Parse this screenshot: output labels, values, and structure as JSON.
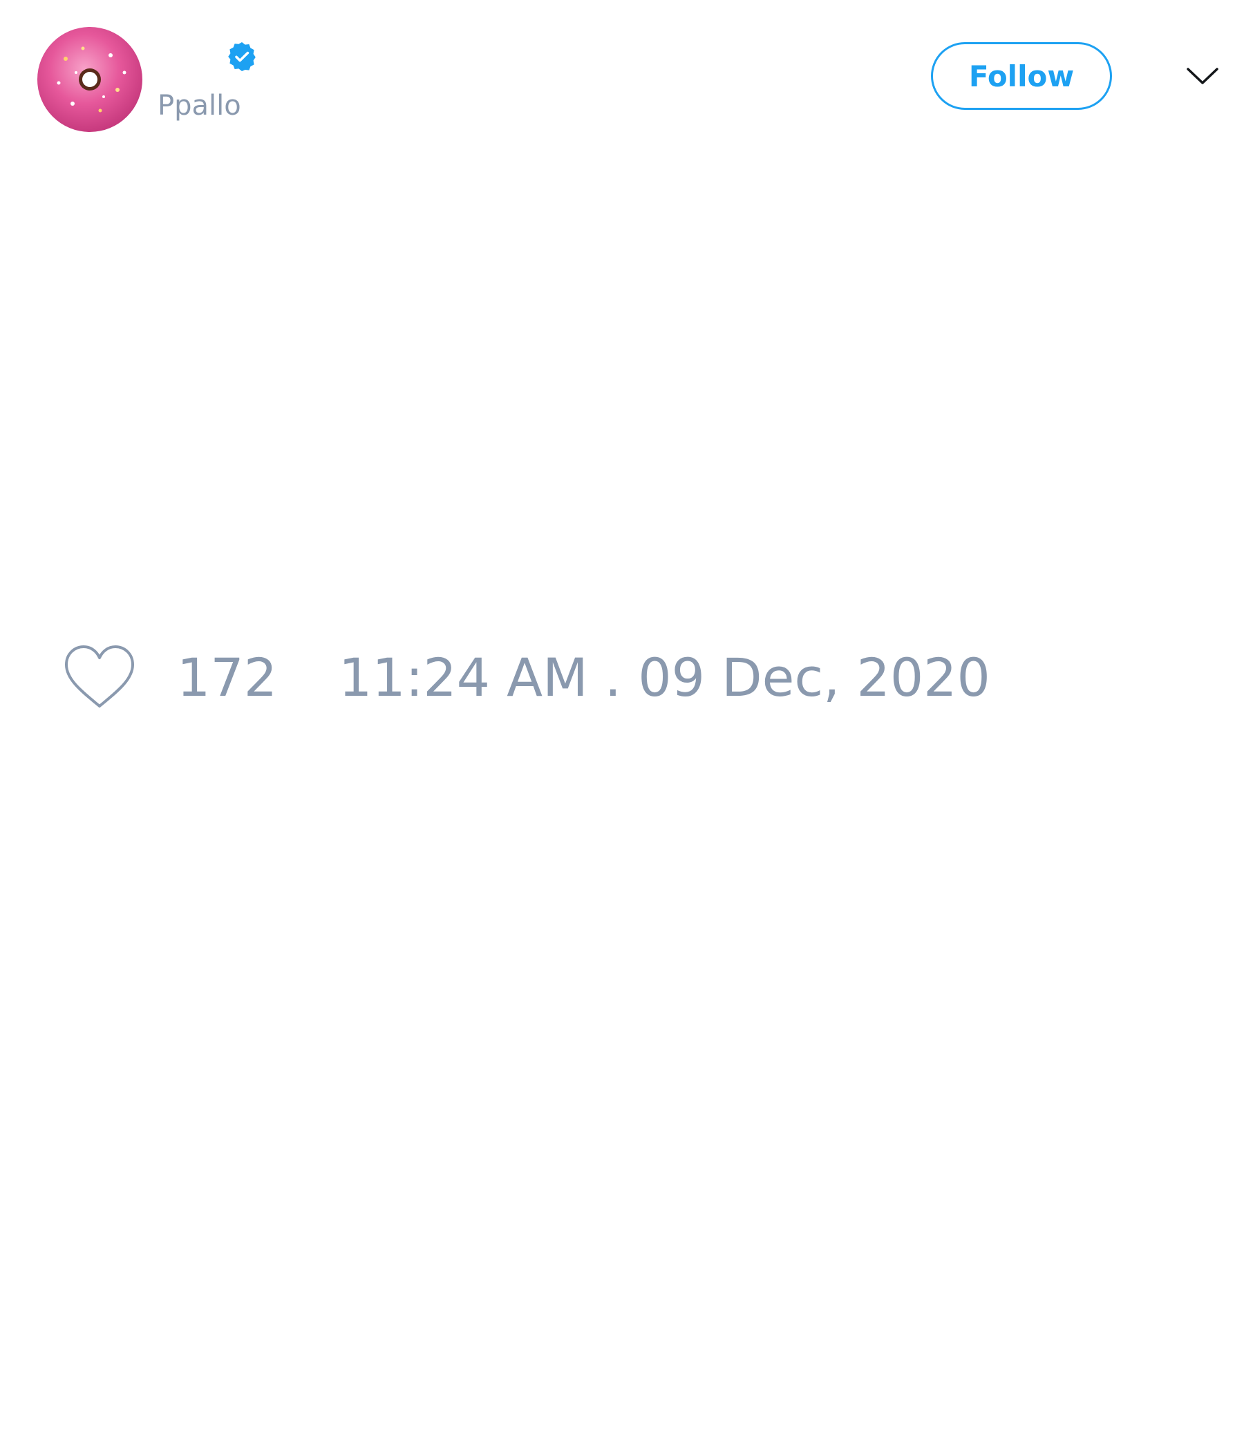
{
  "tweet": {
    "author": {
      "display_name": "",
      "handle": "Ppallo",
      "verified": true,
      "avatar_icon": "pink-donut-avatar"
    },
    "follow_label": "Follow",
    "menu_icon": "chevron-down-icon",
    "body_text": "",
    "likes": "172",
    "timestamp": "11:24 AM . 09 Dec, 2020"
  },
  "colors": {
    "accent": "#1da1f2",
    "muted_text": "#8a99ae",
    "background": "#ffffff",
    "heart_outline": "#8a99ae",
    "avatar_pink": "#e6589b"
  }
}
